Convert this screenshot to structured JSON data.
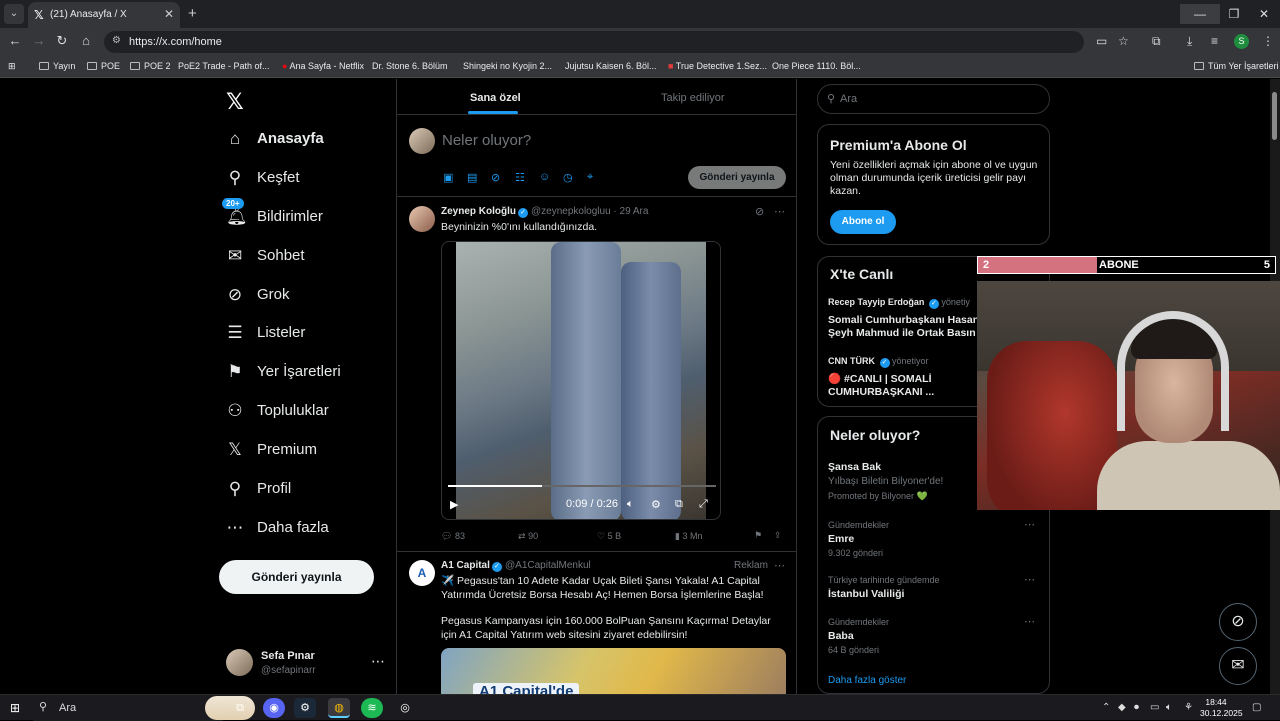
{
  "browser": {
    "tab_title": "(21) Anasayfa / X",
    "url": "https://x.com/home",
    "bookmarks": [
      "Yayın",
      "POE",
      "POE 2",
      "PoE2 Trade - Path of...",
      "Ana Sayfa - Netflix",
      "Dr. Stone 6. Bölüm",
      "Shingeki no Kyojin 2...",
      "Jujutsu Kaisen 6. Böl...",
      "True Detective 1.Sez...",
      "One Piece 1110. Böl..."
    ],
    "bookmarks_all": "Tüm Yer İşaretleri",
    "profile_initial": "S"
  },
  "sidebar": {
    "items": [
      {
        "label": "Anasayfa",
        "icon": "home-icon"
      },
      {
        "label": "Keşfet",
        "icon": "search-icon"
      },
      {
        "label": "Bildirimler",
        "icon": "bell-icon",
        "badge": "20+"
      },
      {
        "label": "Sohbet",
        "icon": "mail-icon"
      },
      {
        "label": "Grok",
        "icon": "grok-icon"
      },
      {
        "label": "Listeler",
        "icon": "list-icon"
      },
      {
        "label": "Yer İşaretleri",
        "icon": "bookmark-icon"
      },
      {
        "label": "Topluluklar",
        "icon": "communities-icon"
      },
      {
        "label": "Premium",
        "icon": "x-icon"
      },
      {
        "label": "Profil",
        "icon": "profile-icon"
      },
      {
        "label": "Daha fazla",
        "icon": "more-icon"
      }
    ],
    "post_button": "Gönderi yayınla",
    "user": {
      "name": "Sefa Pınar",
      "handle": "@sefapinarr"
    }
  },
  "timeline": {
    "tabs": [
      "Sana özel",
      "Takip ediliyor"
    ],
    "compose_placeholder": "Neler oluyor?",
    "compose_post": "Gönderi yayınla",
    "tweet1": {
      "name": "Zeynep Koloğlu",
      "meta": "@zeynepkologluu · 29 Ara",
      "text": "Beyninizin %0'ını kullandığınızda.",
      "video_time": "0:09 / 0:26",
      "video_progress": 0.35,
      "replies": "83",
      "reposts": "90",
      "likes": "5 B",
      "views": "3 Mn"
    },
    "tweet2": {
      "name": "A1 Capital",
      "meta": "@A1CapitalMenkul",
      "ad_label": "Reklam",
      "text1": "✈️ Pegasus'tan 10 Adete Kadar Uçak Bileti Şansı Yakala! A1 Capital Yatırımda Ücretsiz Borsa Hesabı Aç! Hemen Borsa İşlemlerine Başla!",
      "text2": "Pegasus Kampanyası için 160.000 BolPuan Şansını Kaçırma! Detaylar için A1 Capital Yatırım web sitesini ziyaret edebilirsin!",
      "image_text": "A1 Capital'de"
    }
  },
  "right": {
    "search_placeholder": "Ara",
    "premium": {
      "title": "Premium'a Abone Ol",
      "text": "Yeni özellikleri açmak için abone ol ve uygun olman durumunda içerik üreticisi gelir payı kazan.",
      "button": "Abone ol"
    },
    "live": {
      "title": "X'te Canlı",
      "items": [
        {
          "source": "Recep Tayyip Erdoğan",
          "suffix": "yönetiy",
          "l1": "Somali Cumhurbaşkanı Hasan",
          "l2": "Şeyh Mahmud ile Ortak Basın ..."
        },
        {
          "source": "CNN TÜRK",
          "suffix": "yönetiyor",
          "l1": "🔴 #CANLI | SOMALİ",
          "l2": "CUMHURBAŞKANI ..."
        }
      ]
    },
    "trends": {
      "title": "Neler oluyor?",
      "promo": {
        "name": "Şansa Bak",
        "sub": "Yılbaşı Biletin Bilyoner'de!",
        "promo": "Promoted by Bilyoner 💚"
      },
      "items": [
        {
          "cat": "Gündemdekiler",
          "name": "Emre",
          "count": "9.302 gönderi"
        },
        {
          "cat": "Türkiye tarihinde gündemde",
          "name": "İstanbul Valiliği",
          "count": ""
        },
        {
          "cat": "Gündemdekiler",
          "name": "Baba",
          "count": "64 B gönderi"
        }
      ],
      "show_more": "Daha fazla göster"
    }
  },
  "overlay": {
    "left_count": "2",
    "label": "ABONE",
    "right_count": "5",
    "fill_fraction": 0.4
  },
  "taskbar": {
    "search": "Ara",
    "time": "18:44",
    "date": "30.12.2025"
  },
  "colors": {
    "accent": "#1d9bf0",
    "background": "#000000",
    "subbar": "#d4727f"
  }
}
